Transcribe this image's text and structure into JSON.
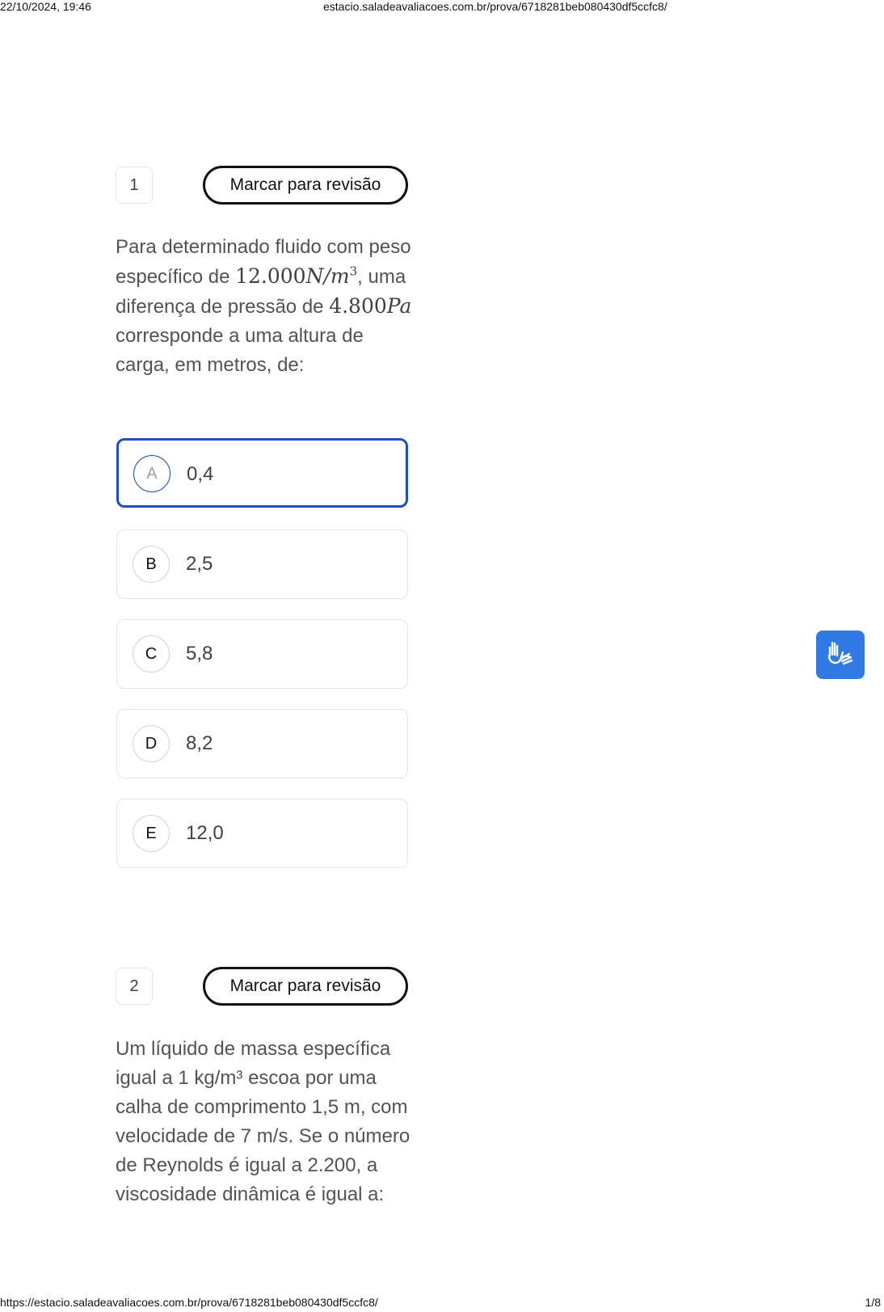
{
  "print_header": {
    "datetime": "22/10/2024, 19:46",
    "page_title": "estacio.saladeavaliacoes.com.br/prova/6718281beb080430df5ccfc8/"
  },
  "print_footer": {
    "url": "https://estacio.saladeavaliacoes.com.br/prova/6718281beb080430df5ccfc8/",
    "page": "1/8"
  },
  "questions": [
    {
      "number": "1",
      "review_label": "Marcar para revisão",
      "text_before": "Para determinado fluido com peso específico de ",
      "math1_num": "12.000",
      "math1_unit": "N/m",
      "math1_exp": "3",
      "text_middle": ", uma diferença de pressão de ",
      "math2_num": "4.800",
      "math2_unit": "Pa",
      "text_after": " corresponde a uma altura de carga, em metros, de:",
      "options": [
        {
          "letter": "A",
          "value": "0,4"
        },
        {
          "letter": "B",
          "value": "2,5"
        },
        {
          "letter": "C",
          "value": "5,8"
        },
        {
          "letter": "D",
          "value": "8,2"
        },
        {
          "letter": "E",
          "value": "12,0"
        }
      ],
      "selected": "A"
    },
    {
      "number": "2",
      "review_label": "Marcar para revisão",
      "text": "Um líquido de massa específica igual a 1 kg/m³ escoa por uma calha de comprimento 1,5 m, com velocidade de 7 m/s. Se o número de Reynolds é igual a 2.200, a viscosidade dinâmica é igual a:"
    }
  ],
  "accessibility": {
    "icon": "sign-language-hands-icon",
    "color": "#2f7be3"
  },
  "colors": {
    "selected_border": "#1e4fc2",
    "text": "#52525b"
  }
}
